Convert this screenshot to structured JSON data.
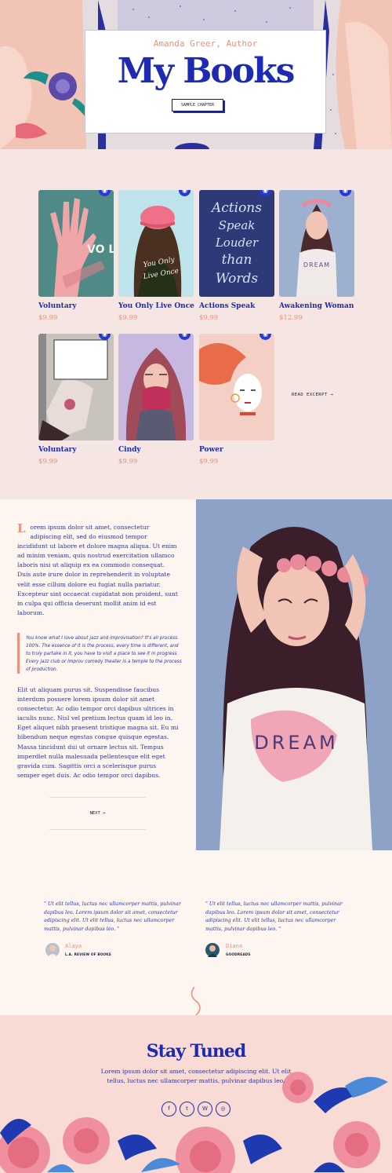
{
  "hero": {
    "author": "Amanda Greer, Author",
    "title": "My Books",
    "cta_label": "SAMPLE CHAPTER"
  },
  "books": [
    {
      "title": "Voluntary",
      "price": "$9.99",
      "cover_text": "VO LUN TARY"
    },
    {
      "title": "You Only Live Once",
      "price": "$9.99",
      "cover_text": "You Only Live Once"
    },
    {
      "title": "Actions Speak",
      "price": "$9.99",
      "cover_text": "Actions Speak Louder than Words"
    },
    {
      "title": "Awakening Woman",
      "price": "$12.99",
      "cover_text": "DREAM"
    },
    {
      "title": "Voluntary",
      "price": "$9.99",
      "cover_text": ""
    },
    {
      "title": "Cindy",
      "price": "$9.99",
      "cover_text": ""
    },
    {
      "title": "Power",
      "price": "$9.99",
      "cover_text": ""
    }
  ],
  "read_excerpt": "READ EXCERPT",
  "article": {
    "dropcap": "L",
    "para1": "orem ipsum dolor sit amet, consectetur adipiscing elit, sed do eiusmod tempor incididunt ut labore et dolore magna aliqua. Ut enim ad minim veniam, quis nostrud exercitation ullamco laboris nisi ut aliquip ex ea commodo consequat. Duis aute irure dolor in reprehenderit in voluptate velit esse cillum dolore eu fugiat nulla pariatur. Excepteur sint occaecat cupidatat non proident, sunt in culpa qui officia deserunt mollit anim id est laborum.",
    "quote": "You know what I love about jazz and improvisation? It's all process. 100%. The essence of it is the process, every time is different, and to truly partake in it, you have to visit a place to see it in progress. Every jazz club or improv comedy theater is a temple to the process of production.",
    "para2": "Elit ut aliquam purus sit. Suspendisse faucibus interdum posuere lorem ipsum dolor sit amet consectetur. Ac odio tempor orci dapibus ultrices in iaculis nunc. Nisl vel pretium lectus quam id leo in. Eget aliquet nibh praesent tristique magna sit. Eu mi bibendum neque egestas congue quisque egestas. Massa tincidunt dui ut ornare lectus sit. Tempus imperdiet nulla malesuada pellentesque elit eget gravida cum. Sagittis orci a scelerisque purus semper eget duis. Ac odio tempor orci dapibus.",
    "next_label": "NEXT",
    "image_text": "DREAM"
  },
  "testimonials": [
    {
      "quote": "\" Ut elit tellus, luctus nec ullamcorper mattis, pulvinar dapibus leo. Lorem ipsum dolor sit amet, consectetur adipiscing elit. Ut elit tellus, luctus nec ullamcorper mattis, pulvinar dapibus leo. \"",
      "name": "Alaya",
      "source": "L.A. REVIEW OF BOOKS"
    },
    {
      "quote": "\" Ut elit tellus, luctus nec ullamcorper mattis, pulvinar dapibus leo. Lorem ipsum dolor sit amet, consectetur adipiscing elit. Ut elit tellus, luctus nec ullamcorper mattis, pulvinar dapibus leo. \"",
      "name": "Diana",
      "source": "GOODREADS"
    }
  ],
  "newsletter": {
    "title": "Stay Tuned",
    "text": "Lorem ipsum dolor sit amet, consectetur adipiscing elit. Ut elit tellus, luctus nec ullamcorper mattis, pulvinar dapibus leo."
  },
  "social": [
    "facebook-icon",
    "twitter-icon",
    "wordpress-icon",
    "instagram-icon"
  ],
  "colors": {
    "accent": "#1e2bb0",
    "coral": "#ef8f78",
    "blush": "#f5e5e3",
    "cream": "#fcf5f0"
  }
}
